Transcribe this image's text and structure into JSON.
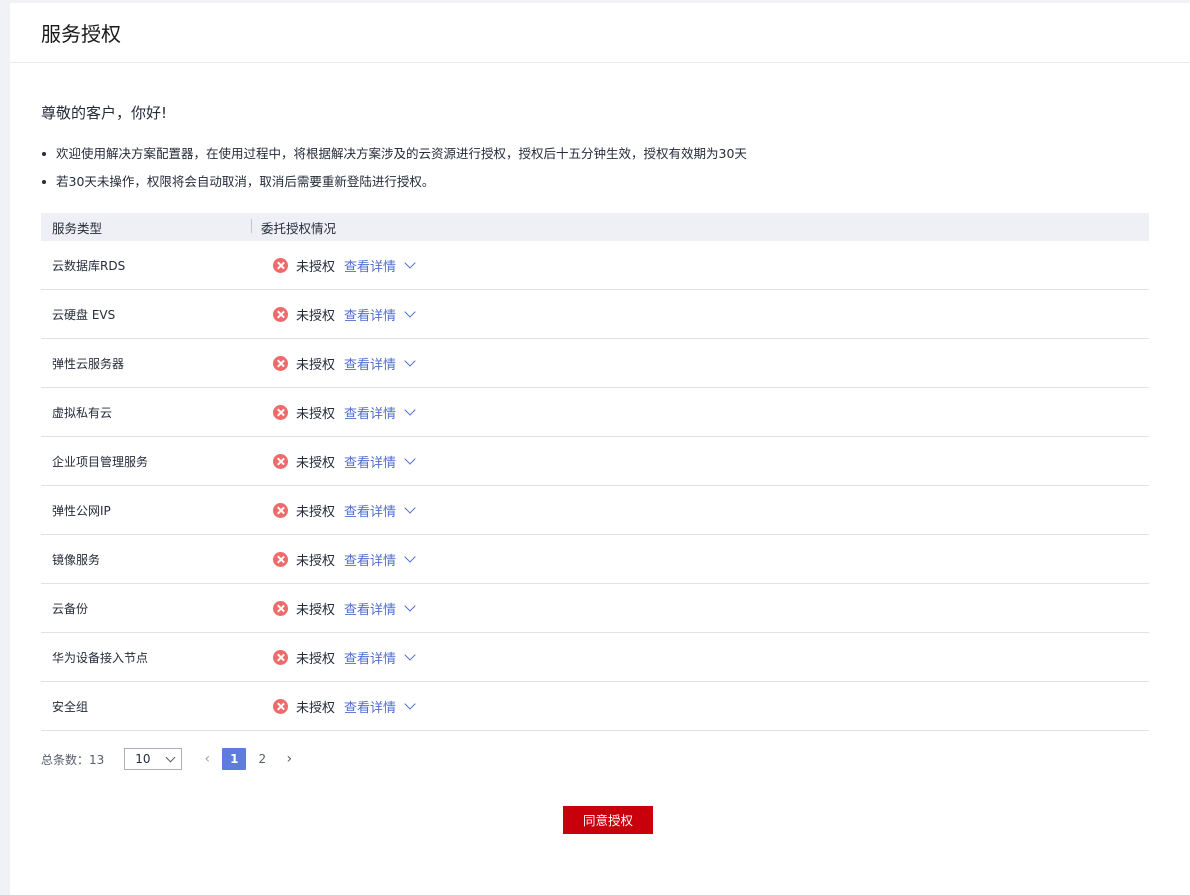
{
  "page_title": "服务授权",
  "greeting": "尊敬的客户，你好!",
  "notes": [
    "欢迎使用解决方案配置器，在使用过程中，将根据解决方案涉及的云资源进行授权，授权后十五分钟生效，授权有效期为30天",
    "若30天未操作，权限将会自动取消，取消后需要重新登陆进行授权。"
  ],
  "table": {
    "headers": [
      "服务类型",
      "委托授权情况"
    ],
    "status_label": "未授权",
    "detail_label": "查看详情",
    "rows": [
      {
        "service": "云数据库RDS"
      },
      {
        "service": "云硬盘 EVS"
      },
      {
        "service": "弹性云服务器"
      },
      {
        "service": "虚拟私有云"
      },
      {
        "service": "企业项目管理服务"
      },
      {
        "service": "弹性公网IP"
      },
      {
        "service": "镜像服务"
      },
      {
        "service": "云备份"
      },
      {
        "service": "华为设备接入节点"
      },
      {
        "service": "安全组"
      }
    ]
  },
  "pagination": {
    "total_label": "总条数：13",
    "page_size": "10",
    "pages": [
      "1",
      "2"
    ],
    "current_page": "1",
    "prev_icon": "chevron-left-icon",
    "next_icon": "chevron-right-icon"
  },
  "agree_button": "同意授权",
  "colors": {
    "accent": "#526ecc",
    "error": "#ef6b6b",
    "primary_button": "#c7000b",
    "active_page": "#5e7ce0"
  }
}
